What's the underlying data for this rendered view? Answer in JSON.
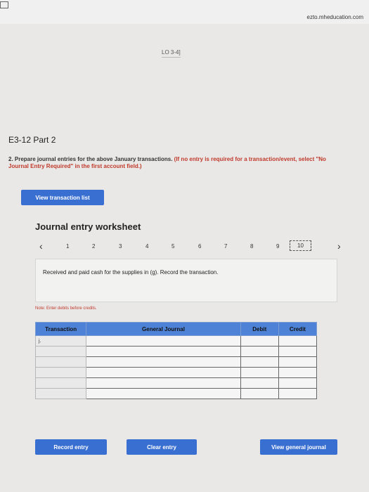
{
  "browser": {
    "url": "ezto.mheducation.com"
  },
  "header": {
    "lo_ref": "LO 3-4]"
  },
  "problem": {
    "title": "E3-12 Part 2",
    "instruction_main": "2. Prepare journal entries for the above January transactions.",
    "instruction_note": "(If no entry is required for a transaction/event, select \"No Journal Entry Required\" in the first account field.)"
  },
  "buttons": {
    "view_transaction_list": "View transaction list",
    "record_entry": "Record entry",
    "clear_entry": "Clear entry",
    "view_general_journal": "View general journal"
  },
  "worksheet": {
    "title": "Journal entry worksheet",
    "pages": [
      "1",
      "2",
      "3",
      "4",
      "5",
      "6",
      "7",
      "8",
      "9",
      "10"
    ],
    "active_page": "10",
    "description": "Received and paid cash for the supplies in (g). Record the transaction.",
    "note": "Note: Enter debits before credits."
  },
  "journal": {
    "columns": [
      "Transaction",
      "General Journal",
      "Debit",
      "Credit"
    ],
    "transaction_label": "j."
  }
}
